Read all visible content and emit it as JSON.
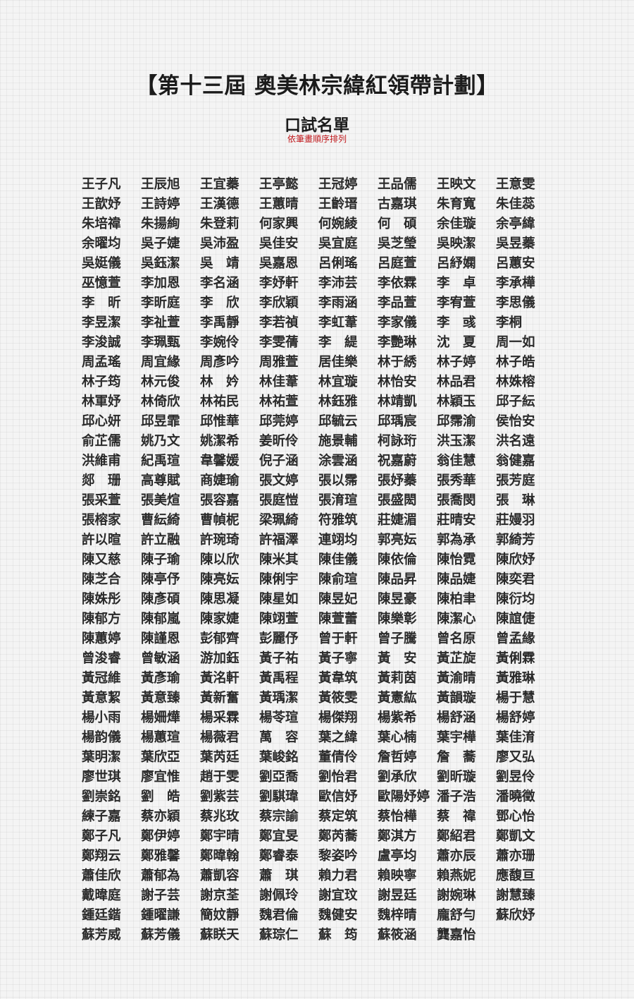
{
  "header": {
    "title": "【第十三屆 奧美林宗緯紅領帶計劃】",
    "subtitle": "口試名單",
    "note": "依筆畫順序排列"
  },
  "names": [
    "王子凡",
    "王辰旭",
    "王宜蓁",
    "王亭懿",
    "王冠婷",
    "王品儒",
    "王映文",
    "王意雯",
    "王歆妤",
    "王詩婷",
    "王漢德",
    "王蕙晴",
    "王齡瑨",
    "古嘉琪",
    "朱育寬",
    "朱佳蕊",
    "朱培禕",
    "朱揚絢",
    "朱登莉",
    "何家興",
    "何婉綾",
    "何　碩",
    "余佳璇",
    "余亭緯",
    "余曜均",
    "吳子婕",
    "吳沛盈",
    "吳佳安",
    "吳宜庭",
    "吳芝瑩",
    "吳映潔",
    "吳昱蓁",
    "吳娗儀",
    "吳鈺潔",
    "吳　靖",
    "吳嘉恩",
    "呂俐瑤",
    "呂庭萱",
    "呂紓嫻",
    "呂蕙安",
    "巫憶萱",
    "李加恩",
    "李名涵",
    "李妤軒",
    "李沛芸",
    "李依霖",
    "李　卓",
    "李承樺",
    "李　昕",
    "李昕庭",
    "李　欣",
    "李欣穎",
    "李雨涵",
    "李品萱",
    "李宥萱",
    "李思儀",
    "李昱潔",
    "李祉萱",
    "李禹靜",
    "李若禎",
    "李虹葦",
    "李家儀",
    "李　彧",
    "李桐",
    "李浚誠",
    "李珮甄",
    "李婉伶",
    "李雯蒨",
    "李　緹",
    "李艷琳",
    "沈　夏",
    "周一如",
    "周孟瑤",
    "周宜緣",
    "周彥吟",
    "周雅萱",
    "居佳樂",
    "林于綉",
    "林子婷",
    "林子皓",
    "林子筠",
    "林元俊",
    "林　妗",
    "林佳葦",
    "林宜璇",
    "林怡安",
    "林品君",
    "林姝榕",
    "林軍妤",
    "林倚欣",
    "林祐民",
    "林祐萱",
    "林鈺雅",
    "林靖凱",
    "林穎玉",
    "邱子紜",
    "邱心妍",
    "邱昱霏",
    "邱惟華",
    "邱莞婷",
    "邱毓云",
    "邱瑀宸",
    "邱霈渝",
    "侯怡安",
    "俞芷儒",
    "姚乃文",
    "姚潔希",
    "姜昕伶",
    "施景輔",
    "柯詠珩",
    "洪玉潔",
    "洪名遠",
    "洪維甫",
    "紀禹瑄",
    "韋馨媛",
    "倪子涵",
    "涂雲涵",
    "祝嘉蔚",
    "翁佳慧",
    "翁健嘉",
    "郯　珊",
    "高尊賦",
    "商婕瑜",
    "張文婷",
    "張以霈",
    "張妤蓁",
    "張秀華",
    "張芳庭",
    "張采萱",
    "張美煊",
    "張容嘉",
    "張庭愷",
    "張淯瑄",
    "張盛閎",
    "張喬閔",
    "張　琳",
    "張榕家",
    "曹紜綺",
    "曹幀柅",
    "梁珮綺",
    "符雅筑",
    "莊婕湄",
    "莊晴安",
    "莊嫚羽",
    "許以暄",
    "許立融",
    "許琬琦",
    "許福澤",
    "連翊均",
    "郭亮妘",
    "郭為承",
    "郭綺芳",
    "陳又慈",
    "陳子瑜",
    "陳以欣",
    "陳米其",
    "陳佳儀",
    "陳依倫",
    "陳怡霓",
    "陳欣妤",
    "陳芝合",
    "陳亭伃",
    "陳亮妘",
    "陳俐宇",
    "陳俞瑄",
    "陳品昇",
    "陳品婕",
    "陳奕君",
    "陳姝彤",
    "陳彥碩",
    "陳思凝",
    "陳星如",
    "陳昱妃",
    "陳昱豪",
    "陳柏聿",
    "陳衍均",
    "陳郁方",
    "陳郁嵐",
    "陳家婕",
    "陳翊萱",
    "陳萱蕾",
    "陳樂彰",
    "陳潔心",
    "陳誼倢",
    "陳蕙婷",
    "陳謹恩",
    "彭郁齊",
    "彭麗伃",
    "曾于軒",
    "曾子騰",
    "曾名原",
    "曾孟緣",
    "曾浚睿",
    "曾敏涵",
    "游加鈺",
    "黃子祐",
    "黃子寧",
    "黃　安",
    "黃芷旋",
    "黃俐霖",
    "黃冠維",
    "黃彥瑜",
    "黃洺軒",
    "黃禹程",
    "黃韋筑",
    "黃莉茵",
    "黃渝晴",
    "黃雅琳",
    "黃意絜",
    "黃意臻",
    "黃新奮",
    "黃瑀潔",
    "黃筱雯",
    "黃憲紘",
    "黃韻璇",
    "楊于慧",
    "楊小雨",
    "楊姍燁",
    "楊采霖",
    "楊苓瑄",
    "楊傑翔",
    "楊紫希",
    "楊舒涵",
    "楊舒婷",
    "楊韵儀",
    "楊蕙瑄",
    "楊薇君",
    "萬　容",
    "葉之緯",
    "葉心楠",
    "葉宇樺",
    "葉佳淯",
    "葉明潔",
    "葉欣亞",
    "葉芮廷",
    "葉峻銘",
    "董倩伶",
    "詹哲婷",
    "詹　蕎",
    "廖又弘",
    "廖世琪",
    "廖宜惟",
    "趙于雯",
    "劉亞喬",
    "劉怡君",
    "劉承欣",
    "劉昕璇",
    "劉昱伶",
    "劉崇銘",
    "劉　皓",
    "劉紫芸",
    "劉騏瑋",
    "歐信妤",
    "歐陽妤婷",
    "潘子浩",
    "潘曉徵",
    "練子嘉",
    "蔡亦穎",
    "蔡兆玫",
    "蔡宗諭",
    "蔡定筑",
    "蔡怡樺",
    "蔡　禕",
    "鄧心怡",
    "鄭子凡",
    "鄭伊婷",
    "鄭宇晴",
    "鄭宜旻",
    "鄭芮蕎",
    "鄭淇方",
    "鄭紹君",
    "鄭凱文",
    "鄭翔云",
    "鄭雅馨",
    "鄭暐翰",
    "鄭睿泰",
    "黎姿吟",
    "盧亭均",
    "蕭亦辰",
    "蕭亦珊",
    "蕭佳欣",
    "蕭郁為",
    "蕭凱容",
    "蕭　琪",
    "賴力君",
    "賴映寧",
    "賴燕妮",
    "應馥亘",
    "戴暐庭",
    "謝子芸",
    "謝京荃",
    "謝佩玲",
    "謝宜玟",
    "謝昱廷",
    "謝婉琳",
    "謝慧臻",
    "鍾廷鍇",
    "鍾曜謙",
    "簡妏靜",
    "魏君倫",
    "魏健安",
    "魏梓晴",
    "龐舒勻",
    "蘇欣妤",
    "蘇芳威",
    "蘇芳儀",
    "蘇眹天",
    "蘇琮仁",
    "蘇　筠",
    "蘇筱涵",
    "龔嘉怡"
  ]
}
